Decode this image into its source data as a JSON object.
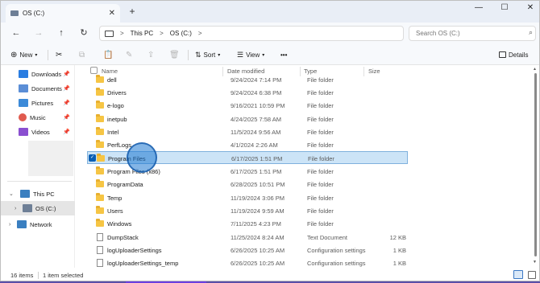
{
  "window": {
    "tab_title": "OS (C:)",
    "close_glyph": "✕",
    "newtab_glyph": "+",
    "minimize_glyph": "—",
    "maximize_glyph": "☐",
    "closewin_glyph": "✕"
  },
  "nav": {
    "back_glyph": "←",
    "forward_glyph": "→",
    "up_glyph": "↑",
    "refresh_glyph": "↻",
    "breadcrumb": [
      "This PC",
      "OS (C:)"
    ],
    "sep_glyph": ">",
    "search_placeholder": "Search OS (C:)"
  },
  "toolbar": {
    "new_label": "New",
    "sort_label": "Sort",
    "view_label": "View",
    "more_label": "•••",
    "details_label": "Details"
  },
  "sidebar": {
    "quick": [
      {
        "label": "Downloads",
        "icon": "download-icon",
        "color": "#2a7de1"
      },
      {
        "label": "Documents",
        "icon": "documents-icon",
        "color": "#5b8ed6"
      },
      {
        "label": "Pictures",
        "icon": "pictures-icon",
        "color": "#3c8ad8"
      },
      {
        "label": "Music",
        "icon": "music-icon",
        "color": "#e05a4e"
      },
      {
        "label": "Videos",
        "icon": "videos-icon",
        "color": "#8a4fd0"
      }
    ],
    "this_pc": "This PC",
    "os_drive": "OS (C:)",
    "network": "Network"
  },
  "columns": {
    "name": "Name",
    "date": "Date modified",
    "type": "Type",
    "size": "Size"
  },
  "files": [
    {
      "name": "dell",
      "date": "9/24/2024 7:14 PM",
      "type": "File folder",
      "size": "",
      "kind": "folder"
    },
    {
      "name": "Drivers",
      "date": "9/24/2024 6:38 PM",
      "type": "File folder",
      "size": "",
      "kind": "folder"
    },
    {
      "name": "e-logo",
      "date": "9/16/2021 10:59 PM",
      "type": "File folder",
      "size": "",
      "kind": "folder"
    },
    {
      "name": "inetpub",
      "date": "4/24/2025 7:58 AM",
      "type": "File folder",
      "size": "",
      "kind": "folder"
    },
    {
      "name": "Intel",
      "date": "11/5/2024 9:56 AM",
      "type": "File folder",
      "size": "",
      "kind": "folder"
    },
    {
      "name": "PerfLogs",
      "date": "4/1/2024 2:26 AM",
      "type": "File folder",
      "size": "",
      "kind": "folder"
    },
    {
      "name": "Program Files",
      "date": "6/17/2025 1:51 PM",
      "type": "File folder",
      "size": "",
      "kind": "folder",
      "selected": true
    },
    {
      "name": "Program Files (x86)",
      "date": "6/17/2025 1:51 PM",
      "type": "File folder",
      "size": "",
      "kind": "folder"
    },
    {
      "name": "ProgramData",
      "date": "6/28/2025 10:51 PM",
      "type": "File folder",
      "size": "",
      "kind": "folder"
    },
    {
      "name": "Temp",
      "date": "11/19/2024 3:06 PM",
      "type": "File folder",
      "size": "",
      "kind": "folder"
    },
    {
      "name": "Users",
      "date": "11/19/2024 9:59 AM",
      "type": "File folder",
      "size": "",
      "kind": "folder"
    },
    {
      "name": "Windows",
      "date": "7/11/2025 4:23 PM",
      "type": "File folder",
      "size": "",
      "kind": "folder"
    },
    {
      "name": "DumpStack",
      "date": "11/25/2024 8:24 AM",
      "type": "Text Document",
      "size": "12 KB",
      "kind": "doc"
    },
    {
      "name": "logUploaderSettings",
      "date": "6/26/2025 10:25 AM",
      "type": "Configuration settings",
      "size": "1 KB",
      "kind": "doc"
    },
    {
      "name": "logUploaderSettings_temp",
      "date": "6/26/2025 10:25 AM",
      "type": "Configuration settings",
      "size": "1 KB",
      "kind": "doc"
    }
  ],
  "status": {
    "items": "16 items",
    "selected": "1 item selected"
  },
  "colors": {
    "accent": "#0a5fb4",
    "selection": "#cce4f7",
    "folder": "#f6c544"
  }
}
